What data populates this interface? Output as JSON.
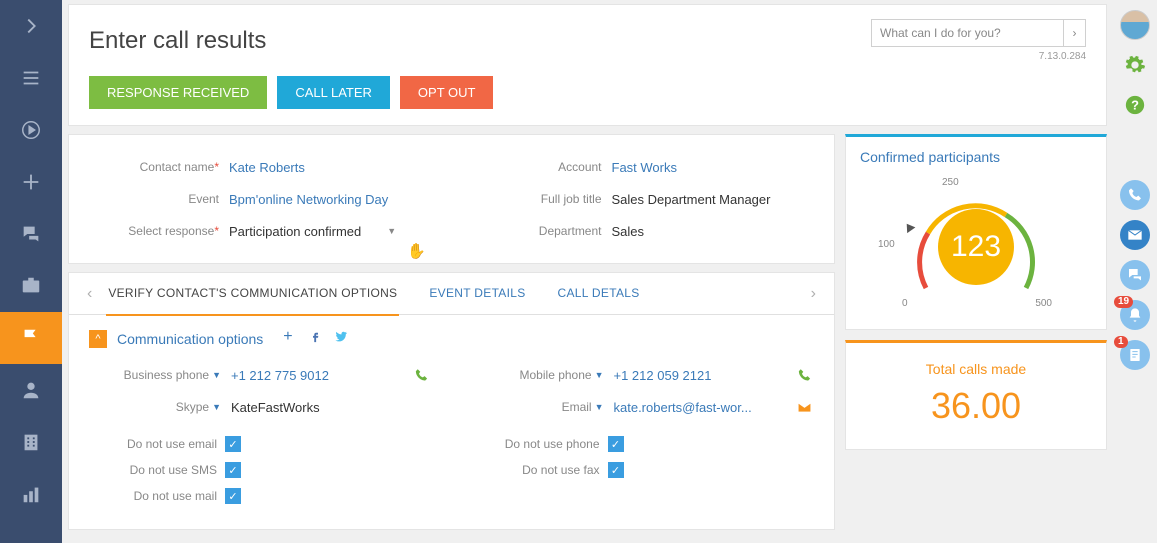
{
  "header": {
    "title": "Enter call results",
    "search_placeholder": "What can I do for you?",
    "version": "7.13.0.284",
    "buttons": {
      "response_received": "RESPONSE RECEIVED",
      "call_later": "CALL LATER",
      "opt_out": "OPT OUT"
    }
  },
  "form": {
    "labels": {
      "contact_name": "Contact name",
      "event": "Event",
      "select_response": "Select response",
      "account": "Account",
      "full_job_title": "Full job title",
      "department": "Department"
    },
    "values": {
      "contact_name": "Kate Roberts",
      "event": "Bpm'online Networking Day",
      "select_response": "Participation confirmed",
      "account": "Fast Works",
      "full_job_title": "Sales Department Manager",
      "department": "Sales"
    }
  },
  "tabs": {
    "verify": "VERIFY CONTACT'S COMMUNICATION OPTIONS",
    "event_details": "EVENT DETAILS",
    "call_details": "CALL DETALS"
  },
  "comm": {
    "section_title": "Communication options",
    "labels": {
      "business_phone": "Business phone",
      "skype": "Skype",
      "mobile_phone": "Mobile phone",
      "email": "Email",
      "dne": "Do not use email",
      "dns": "Do not use SMS",
      "dnm": "Do not use mail",
      "dnp": "Do not use phone",
      "dnf": "Do not use fax"
    },
    "values": {
      "business_phone": "+1 212 775 9012",
      "skype": "KateFastWorks",
      "mobile_phone": "+1 212 059 2121",
      "email": "kate.roberts@fast-wor..."
    },
    "checks": {
      "dne": true,
      "dns": true,
      "dnm": true,
      "dnp": true,
      "dnf": true
    }
  },
  "gauge": {
    "title": "Confirmed participants",
    "value": "123",
    "ticks": {
      "t0": "0",
      "t100": "100",
      "t250": "250",
      "t500": "500"
    }
  },
  "total_calls": {
    "title": "Total calls made",
    "value": "36.00"
  },
  "right_badges": {
    "bell": "19",
    "note": "1"
  },
  "chart_data": {
    "type": "gauge",
    "title": "Confirmed participants",
    "value": 123,
    "range": [
      0,
      500
    ],
    "ticks": [
      0,
      100,
      250,
      500
    ],
    "zones": [
      {
        "from": 0,
        "to": 100,
        "color": "#e74c3c"
      },
      {
        "from": 100,
        "to": 250,
        "color": "#f7b500"
      },
      {
        "from": 250,
        "to": 500,
        "color": "#6cb33f"
      }
    ]
  }
}
